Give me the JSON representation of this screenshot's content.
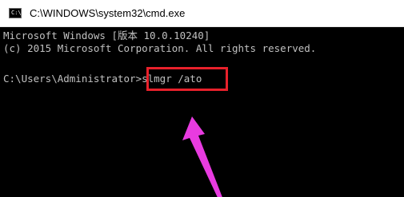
{
  "window": {
    "title": "C:\\WINDOWS\\system32\\cmd.exe",
    "icon": "cmd-console-icon"
  },
  "console": {
    "lines": [
      "Microsoft Windows [版本 10.0.10240]",
      "(c) 2015 Microsoft Corporation. All rights reserved.",
      "C:\\Users\\Administrator>slmgr /ato"
    ]
  },
  "annotation": {
    "box_color": "#e8212b",
    "arrow_color": "#e83be0",
    "target": "slmgr /ato"
  }
}
